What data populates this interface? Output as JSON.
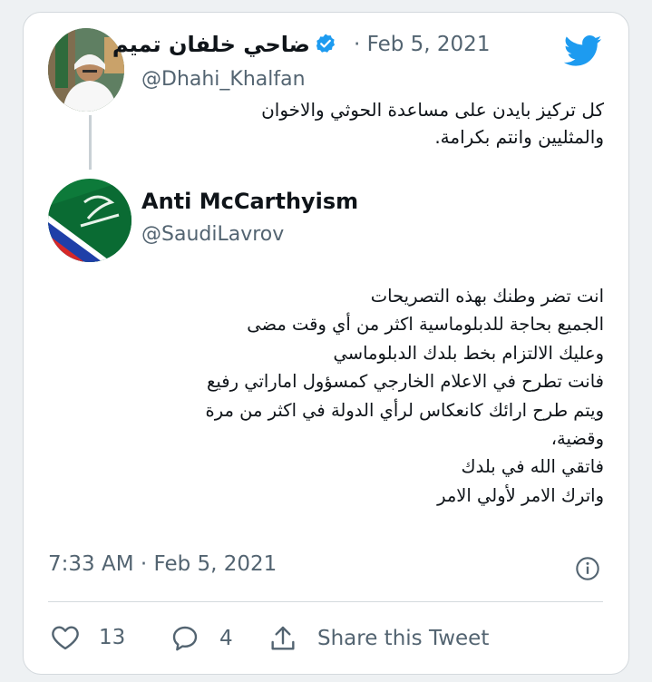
{
  "tweet": {
    "author": {
      "name": "ضاحي خلفان تميم",
      "handle": "@Dhahi_Khalfan",
      "verified": true
    },
    "date": "Feb 5, 2021",
    "text": "كل تركيز بايدن على مساعدة الحوثي والاخوان\nوالمثليين وانتم بكرامة."
  },
  "reply": {
    "author": {
      "name": "Anti McCarthyism",
      "handle": "@SaudiLavrov"
    },
    "text": "انت تضر وطنك بهذه التصريحات\nالجميع بحاجة للدبلوماسية اكثر من أي وقت مضى\nوعليك الالتزام بخط بلدك الدبلوماسي\nفانت تطرح في الاعلام الخارجي كمسؤول اماراتي رفيع\nويتم طرح ارائك كانعكاس لرأي الدولة في اكثر من مرة\nوقضية،\nفاتقي الله في بلدك\nواترك الامر لأولي الامر",
    "timestamp": "7:33 AM · Feb 5, 2021"
  },
  "actions": {
    "like_count": "13",
    "reply_count": "4",
    "share_label": "Share this Tweet"
  },
  "icons": {
    "brand": "twitter-bird-icon",
    "verified": "verified-badge-icon",
    "info": "info-icon",
    "like": "heart-icon",
    "reply": "comment-bubble-icon",
    "share": "share-upload-icon"
  },
  "colors": {
    "twitter_blue": "#1d9bf0",
    "text_primary": "#0f1419",
    "text_secondary": "#536471"
  }
}
